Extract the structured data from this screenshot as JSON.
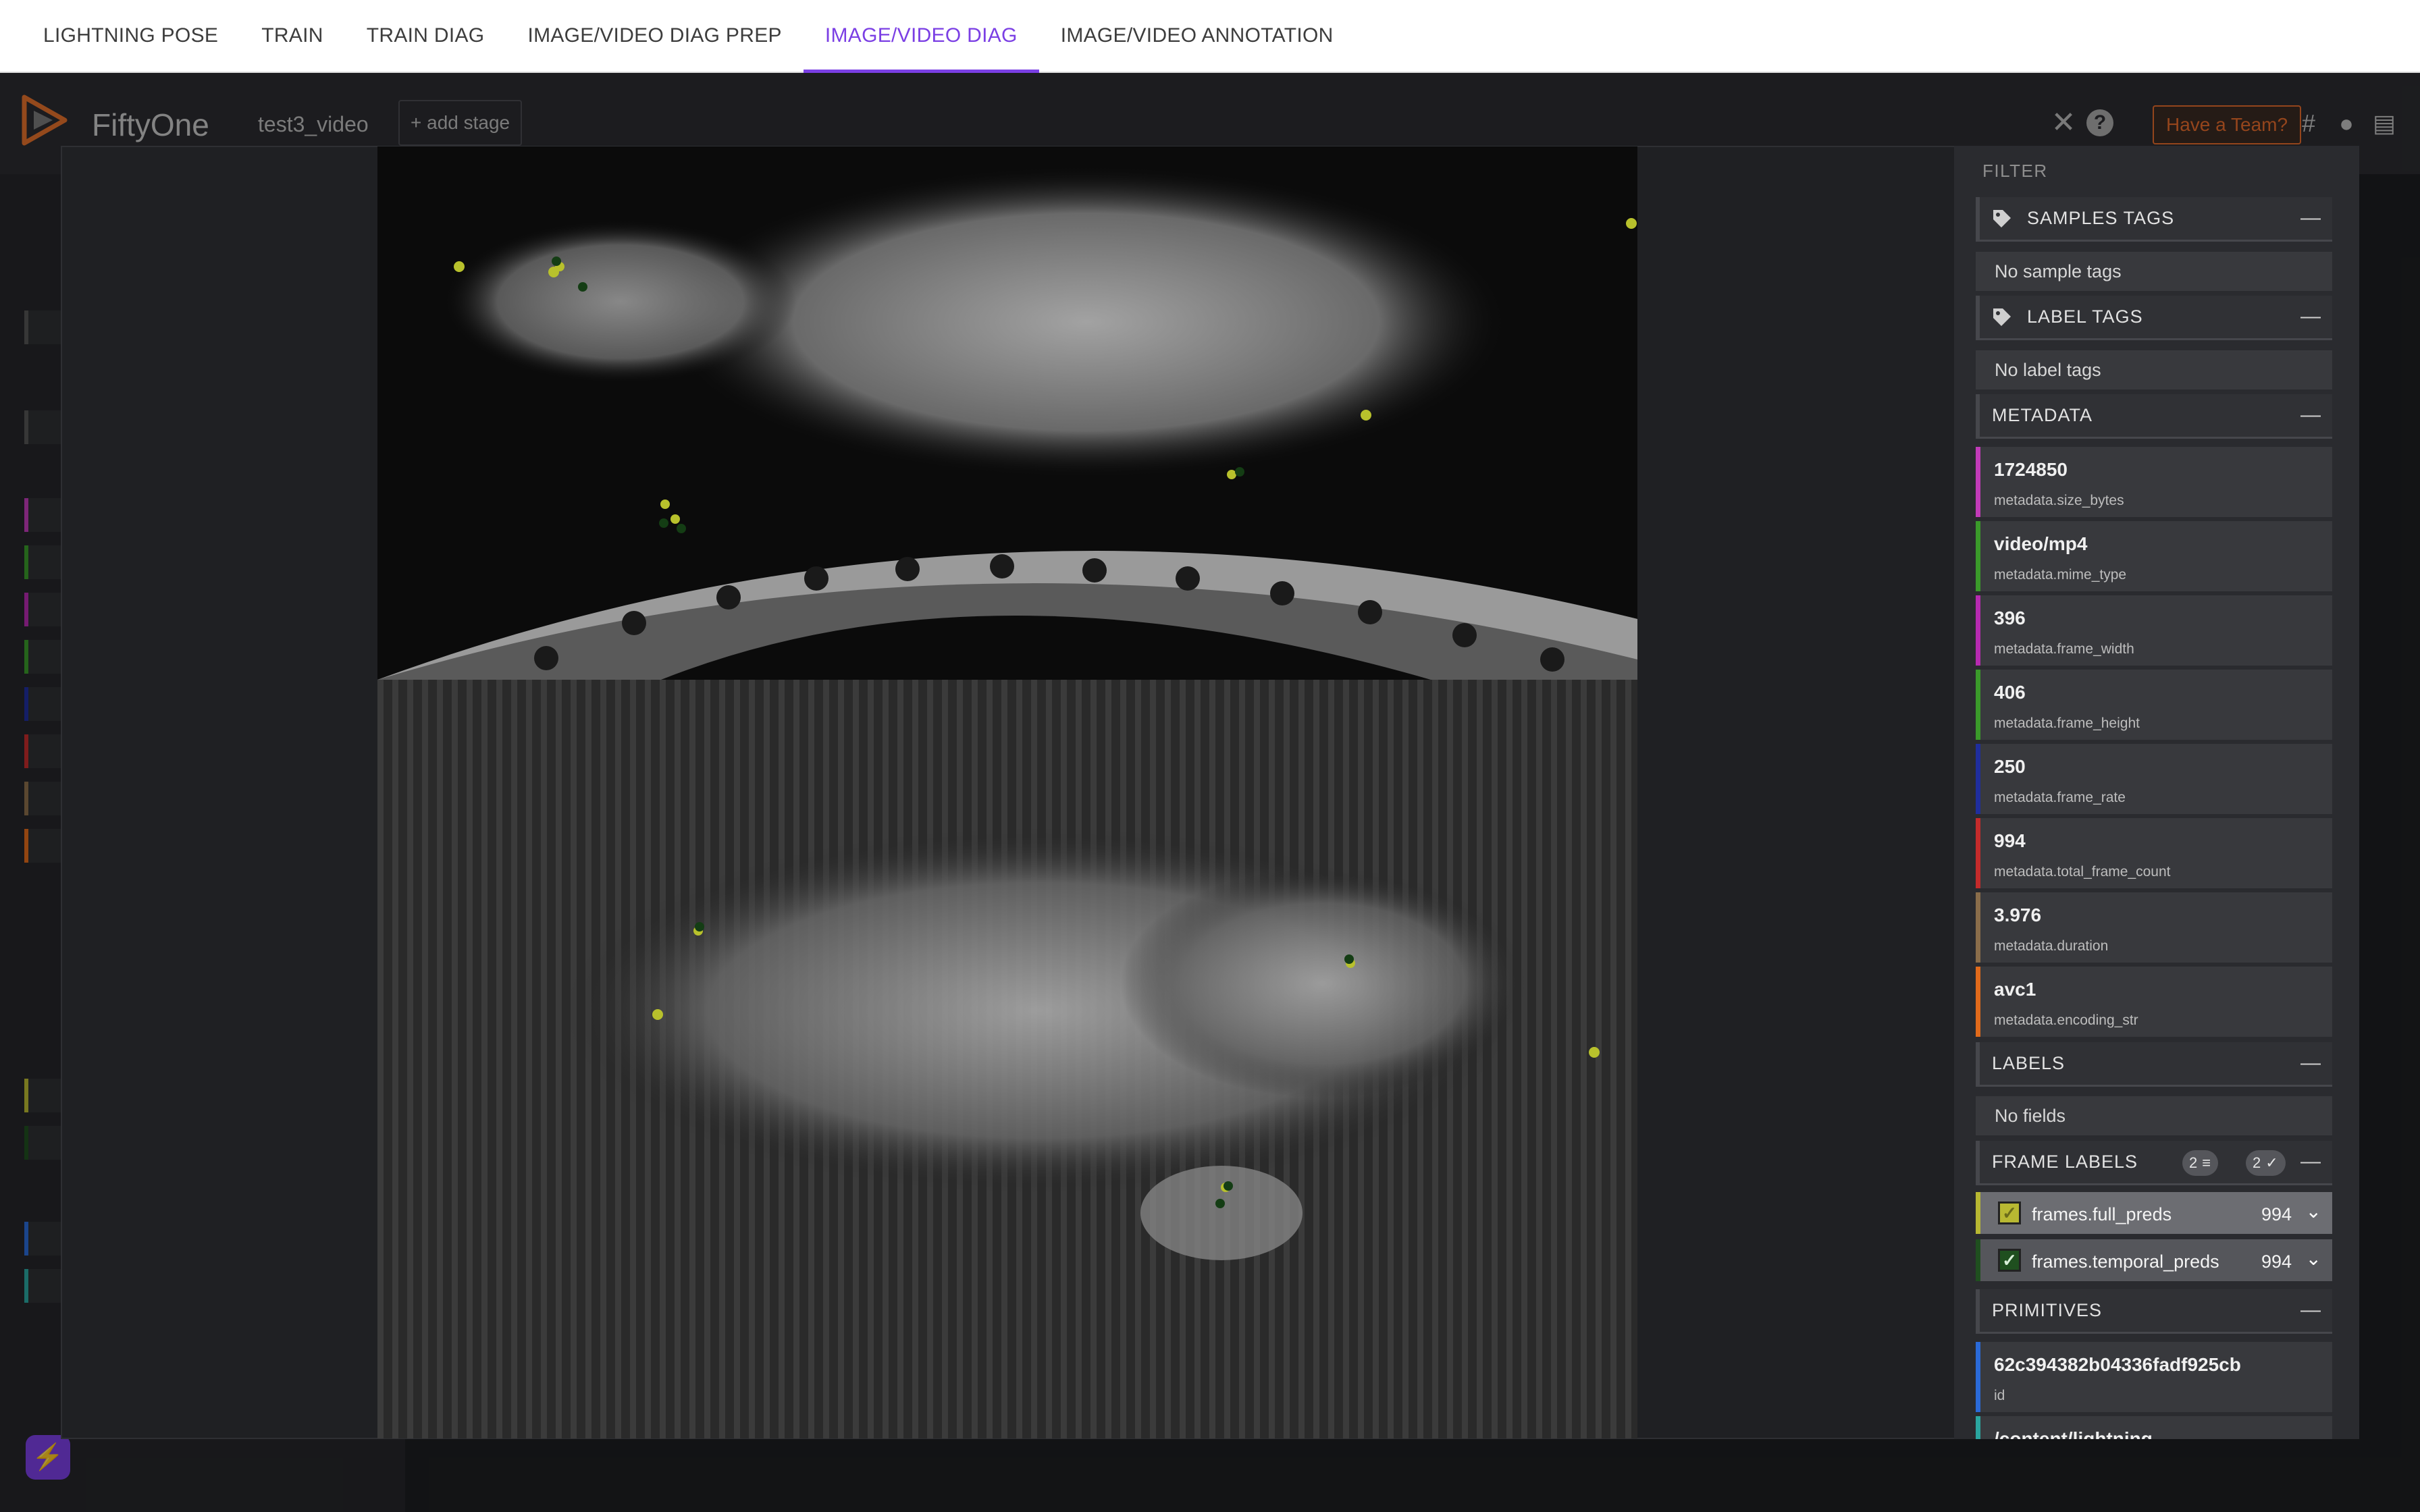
{
  "top_tabs": [
    {
      "label": "LIGHTNING POSE"
    },
    {
      "label": "TRAIN"
    },
    {
      "label": "TRAIN DIAG"
    },
    {
      "label": "IMAGE/VIDEO DIAG PREP"
    },
    {
      "label": "IMAGE/VIDEO DIAG",
      "active": true
    },
    {
      "label": "IMAGE/VIDEO ANNOTATION"
    }
  ],
  "header": {
    "logo_text": "FiftyOne",
    "dataset": "test3_video",
    "add_stage": "+ add stage",
    "team_button": "Have a Team?",
    "icons": [
      "close-icon",
      "help-icon",
      "slack-icon",
      "github-icon",
      "docs-icon"
    ]
  },
  "sidebar": {
    "title": "FILTER",
    "samples_tags": {
      "label": "SAMPLES TAGS",
      "empty": "No sample tags"
    },
    "label_tags": {
      "label": "LABEL TAGS",
      "empty": "No label tags"
    },
    "metadata": {
      "label": "METADATA",
      "items": [
        {
          "value": "1724850",
          "key": "metadata.size_bytes",
          "color": "#c13bb8"
        },
        {
          "value": "video/mp4",
          "key": "metadata.mime_type",
          "color": "#3a9a2a"
        },
        {
          "value": "396",
          "key": "metadata.frame_width",
          "color": "#b62ab0"
        },
        {
          "value": "406",
          "key": "metadata.frame_height",
          "color": "#3a9a2a"
        },
        {
          "value": "250",
          "key": "metadata.frame_rate",
          "color": "#1f2e9e"
        },
        {
          "value": "994",
          "key": "metadata.total_frame_count",
          "color": "#c42b2b"
        },
        {
          "value": "3.976",
          "key": "metadata.duration",
          "color": "#8a6d4a"
        },
        {
          "value": "avc1",
          "key": "metadata.encoding_str",
          "color": "#e06a1b"
        }
      ]
    },
    "labels": {
      "label": "LABELS",
      "empty": "No fields"
    },
    "frame_labels": {
      "label": "FRAME LABELS",
      "filter_count": "2",
      "visible_count": "2",
      "fields": [
        {
          "name": "frames.full_preds",
          "count": "994",
          "color": "#b8b832",
          "bg": "#6c6d72"
        },
        {
          "name": "frames.temporal_preds",
          "count": "994",
          "color": "#1f4f1f",
          "bg": "#55565b"
        }
      ]
    },
    "primitives": {
      "label": "PRIMITIVES",
      "items": [
        {
          "value": "62c394382b04336fadf925cb",
          "key": "id",
          "color": "#2a6ad8"
        },
        {
          "value": "/content/lightning-",
          "key": "",
          "color": "#2aa6a0"
        }
      ]
    }
  },
  "keypoints": {
    "full_preds_color": "#b8c12c",
    "temporal_preds_color": "#143d14"
  }
}
